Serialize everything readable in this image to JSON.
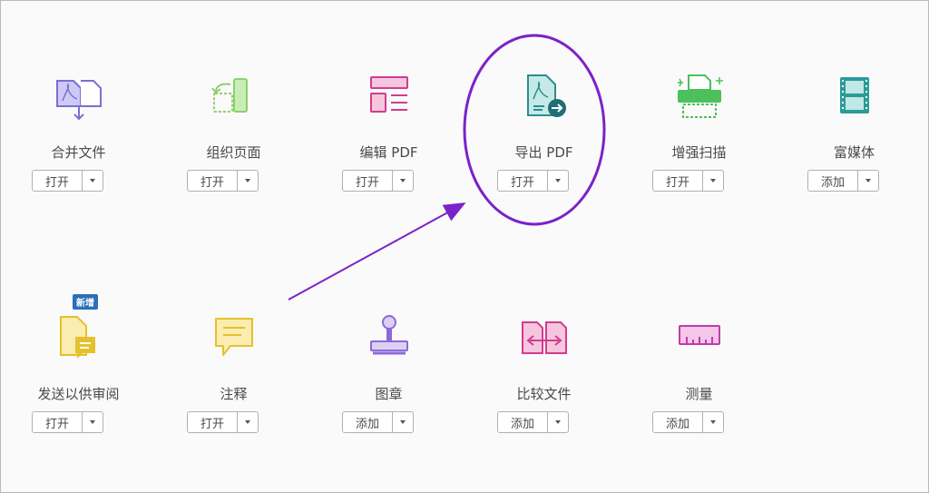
{
  "colors": {
    "annotation": "#7b22c9",
    "background": "#fafafa",
    "border": "#b9b9b9"
  },
  "tools": [
    {
      "label": "合并文件",
      "button": "打开",
      "icon": "combine-files-icon",
      "color": "#7b6fd4"
    },
    {
      "label": "组织页面",
      "button": "打开",
      "icon": "organize-pages-icon",
      "color": "#8dd16a"
    },
    {
      "label": "编辑 PDF",
      "button": "打开",
      "icon": "edit-pdf-icon",
      "color": "#d23c8f"
    },
    {
      "label": "导出 PDF",
      "button": "打开",
      "icon": "export-pdf-icon",
      "color": "#2a8f8c"
    },
    {
      "label": "增强扫描",
      "button": "打开",
      "icon": "enhance-scan-icon",
      "color": "#4cc05c"
    },
    {
      "label": "富媒体",
      "button": "添加",
      "icon": "rich-media-icon",
      "color": "#2a9c9a"
    },
    {
      "label": "发送以供审阅",
      "button": "打开",
      "icon": "send-for-review-icon",
      "color": "#e5c12b",
      "badge": "新增"
    },
    {
      "label": "注释",
      "button": "打开",
      "icon": "comment-icon",
      "color": "#e5c12b"
    },
    {
      "label": "图章",
      "button": "添加",
      "icon": "stamp-icon",
      "color": "#8b6ad6"
    },
    {
      "label": "比较文件",
      "button": "添加",
      "icon": "compare-files-icon",
      "color": "#d23c8f"
    },
    {
      "label": "测量",
      "button": "添加",
      "icon": "measure-icon",
      "color": "#c13ca8"
    }
  ]
}
